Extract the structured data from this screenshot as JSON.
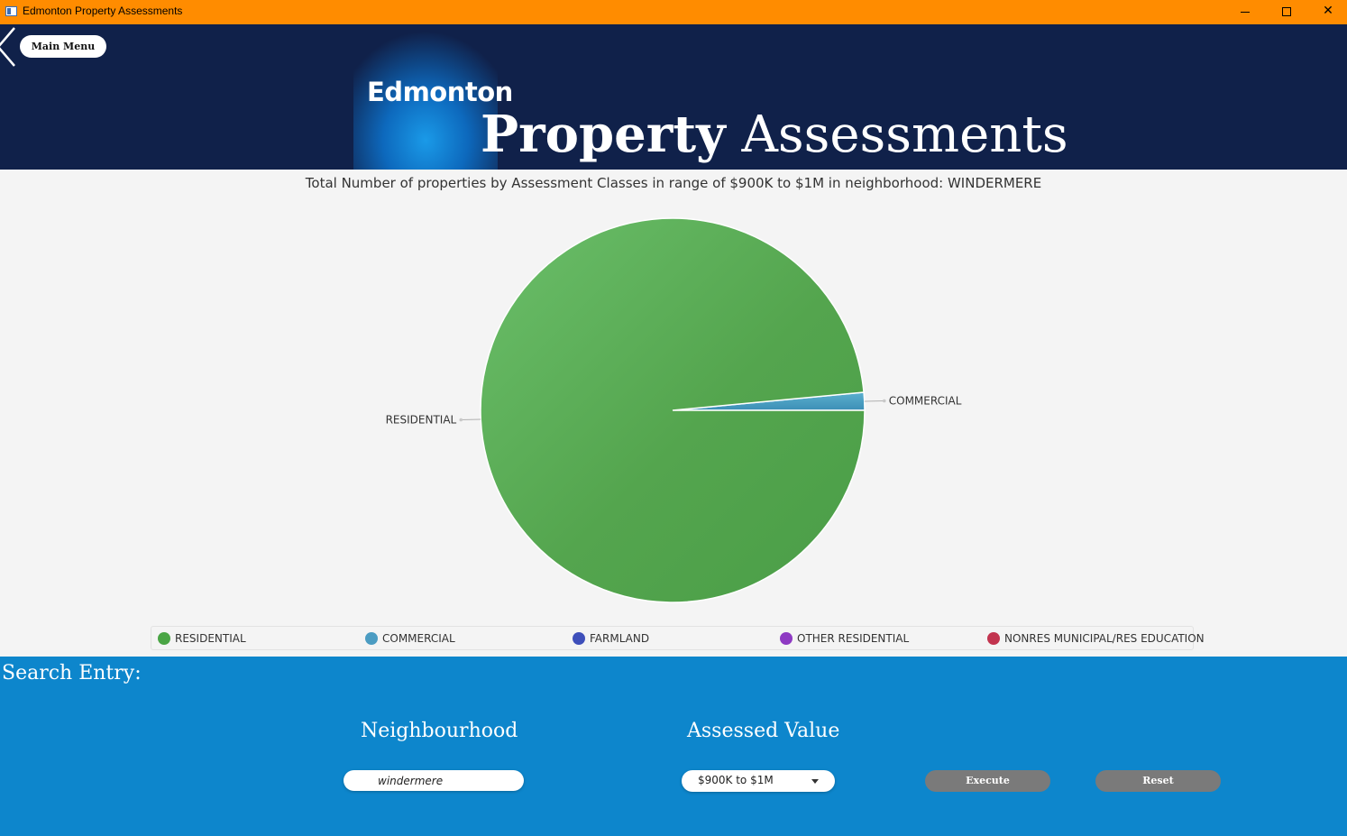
{
  "window": {
    "title": "Edmonton Property Assessments",
    "controls": {
      "minimize": "minimize-icon",
      "maximize": "maximize-icon",
      "close": "✕"
    }
  },
  "header": {
    "main_menu_label": "Main Menu",
    "logo_text": "Edmonton",
    "title_bold": "Property",
    "title_regular": "Assessments",
    "colors": {
      "background": "#10214a",
      "logo_blue": "#0d69bd"
    }
  },
  "chart_data": {
    "type": "pie",
    "title": "Total Number of properties by Assessment Classes in range of $900K to $1M in neighborhood: WINDERMERE",
    "slices": [
      {
        "label": "RESIDENTIAL",
        "value": 0.985,
        "color": "#54a54e"
      },
      {
        "label": "COMMERCIAL",
        "value": 0.015,
        "color": "#4d9fc0"
      }
    ],
    "legend": {
      "placement": "bottom",
      "items": [
        {
          "label": "RESIDENTIAL",
          "color": "#4aa545"
        },
        {
          "label": "COMMERCIAL",
          "color": "#4b9cc2"
        },
        {
          "label": "FARMLAND",
          "color": "#3e4fba"
        },
        {
          "label": "OTHER RESIDENTIAL",
          "color": "#8e3ac3"
        },
        {
          "label": "NONRES MUNICIPAL/RES EDUCATION",
          "color": "#c2344f"
        }
      ]
    }
  },
  "search": {
    "heading": "Search Entry:",
    "neighbourhood_label": "Neighbourhood",
    "neighbourhood_value": "windermere",
    "assessed_value_label": "Assessed Value",
    "assessed_value_selected": "$900K to $1M",
    "execute_label": "Execute",
    "reset_label": "Reset",
    "colors": {
      "panel": "#0d86cc",
      "button": "#7a7a7a"
    }
  }
}
